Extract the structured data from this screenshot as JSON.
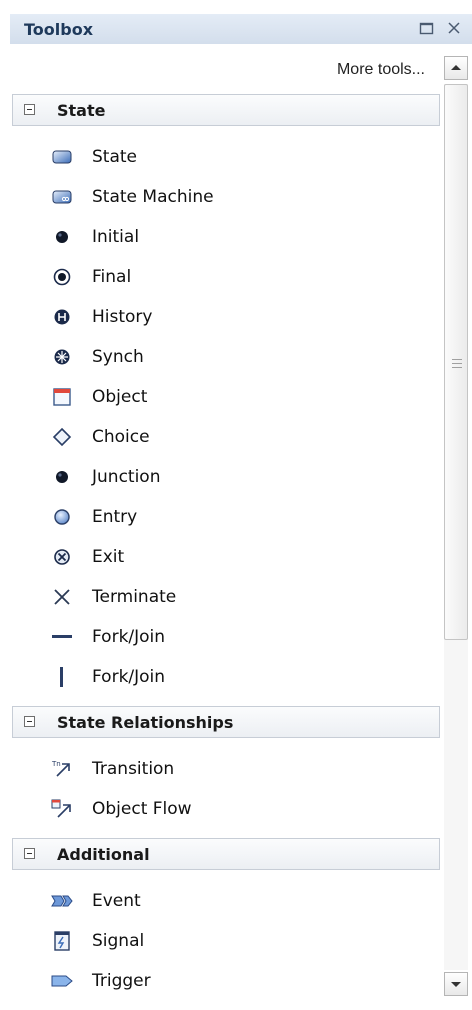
{
  "window": {
    "title": "Toolbox"
  },
  "controls": {
    "maximize_icon": "maximize-icon",
    "close_icon": "close-icon",
    "more_tools": "More tools..."
  },
  "groups": [
    {
      "label": "State",
      "items": [
        {
          "label": "State",
          "icon": "state-icon"
        },
        {
          "label": "State Machine",
          "icon": "state-machine-icon"
        },
        {
          "label": "Initial",
          "icon": "initial-icon"
        },
        {
          "label": "Final",
          "icon": "final-icon"
        },
        {
          "label": "History",
          "icon": "history-icon"
        },
        {
          "label": "Synch",
          "icon": "synch-icon"
        },
        {
          "label": "Object",
          "icon": "object-icon"
        },
        {
          "label": "Choice",
          "icon": "choice-icon"
        },
        {
          "label": "Junction",
          "icon": "junction-icon"
        },
        {
          "label": "Entry",
          "icon": "entry-icon"
        },
        {
          "label": "Exit",
          "icon": "exit-icon"
        },
        {
          "label": "Terminate",
          "icon": "terminate-icon"
        },
        {
          "label": "Fork/Join",
          "icon": "fork-join-horizontal-icon"
        },
        {
          "label": "Fork/Join",
          "icon": "fork-join-vertical-icon"
        }
      ]
    },
    {
      "label": "State Relationships",
      "items": [
        {
          "label": "Transition",
          "icon": "transition-icon"
        },
        {
          "label": "Object Flow",
          "icon": "object-flow-icon"
        }
      ]
    },
    {
      "label": "Additional",
      "items": [
        {
          "label": "Event",
          "icon": "event-icon"
        },
        {
          "label": "Signal",
          "icon": "signal-icon"
        },
        {
          "label": "Trigger",
          "icon": "trigger-icon"
        }
      ]
    }
  ]
}
